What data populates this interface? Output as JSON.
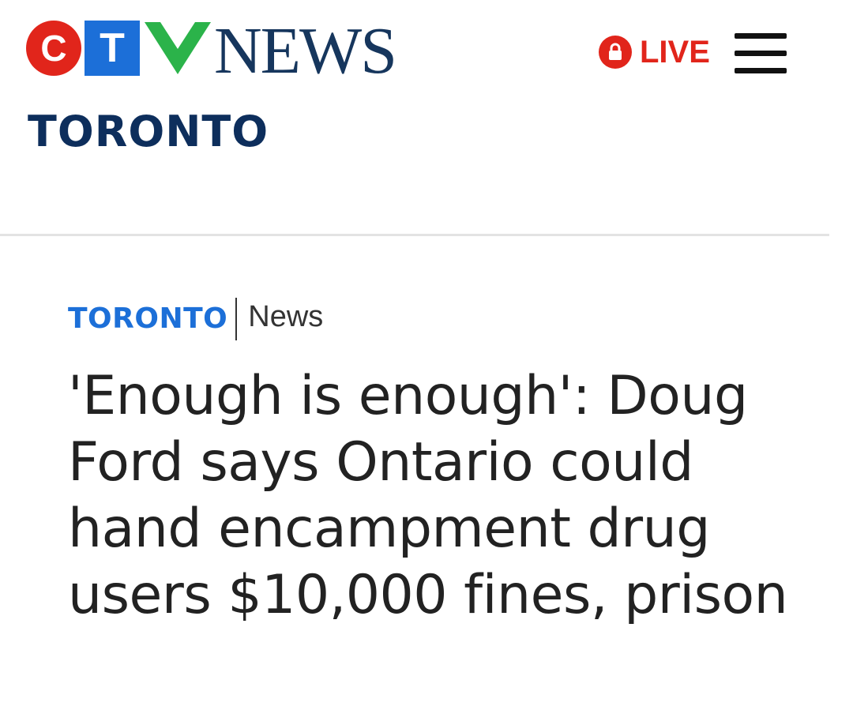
{
  "header": {
    "logo": {
      "letters": [
        "C",
        "T",
        "V"
      ],
      "word": "NEWS",
      "colors": {
        "c": "#e1251b",
        "t": "#1c6fd8",
        "v": "#2bb34a",
        "word": "#16365d"
      }
    },
    "live_label": "LIVE",
    "live_icon": "lock-icon",
    "menu_icon": "hamburger-menu-icon",
    "city": "TORONTO"
  },
  "article": {
    "kicker_section": "TORONTO",
    "kicker_category": "News",
    "headline": "'Enough is enough': Doug Ford says Ontario could hand encampment drug users $10,000 fines, prison"
  },
  "colors": {
    "accent_red": "#e1251b",
    "accent_blue": "#1c6fd8",
    "navy": "#0d2e5c",
    "text": "#222222"
  }
}
